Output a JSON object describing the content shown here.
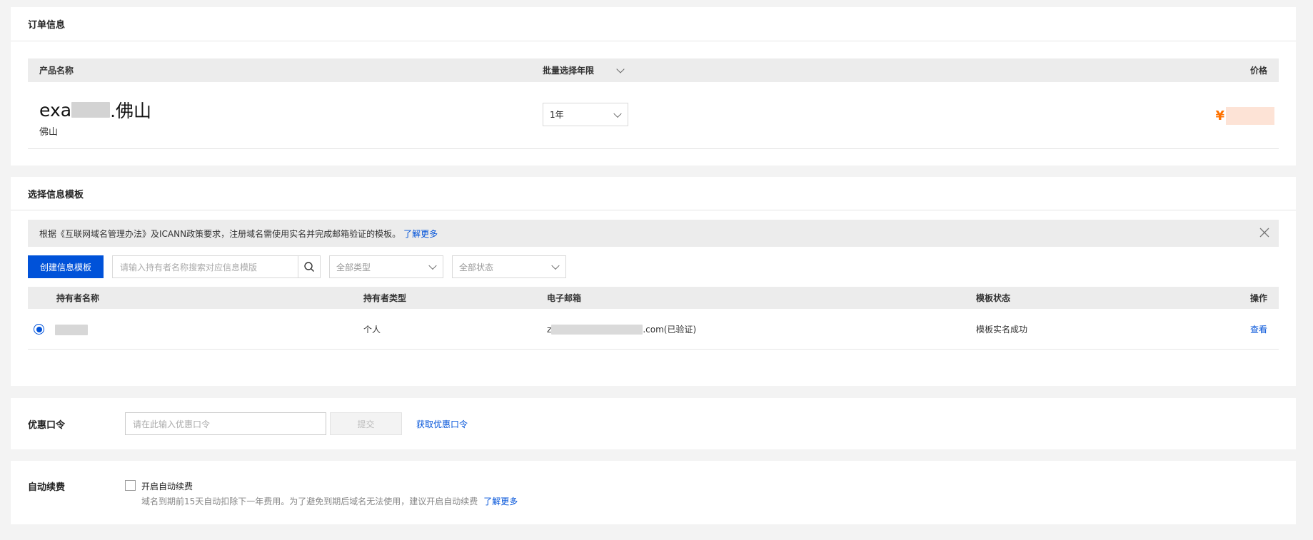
{
  "order": {
    "title": "订单信息",
    "col_product": "产品名称",
    "col_batch": "批量选择年限",
    "col_price": "价格",
    "product_name_prefix": "exa",
    "product_name_suffix": ".佛山",
    "product_sub": "佛山",
    "year_value": "1年",
    "currency": "¥"
  },
  "template": {
    "title": "选择信息模板",
    "notice": "根据《互联网域名管理办法》及ICANN政策要求，注册域名需使用实名并完成邮箱验证的模板。",
    "notice_link": "了解更多",
    "create_button": "创建信息模板",
    "search_placeholder": "请输入持有者名称搜索对应信息模版",
    "type_filter": "全部类型",
    "status_filter": "全部状态",
    "columns": {
      "holder": "持有者名称",
      "type": "持有者类型",
      "email": "电子邮箱",
      "status": "模板状态",
      "action": "操作"
    },
    "rows": [
      {
        "type": "个人",
        "email_prefix": "z",
        "email_suffix": ".com(已验证)",
        "status": "模板实名成功",
        "action": "查看"
      }
    ]
  },
  "coupon": {
    "label": "优惠口令",
    "placeholder": "请在此输入优惠口令",
    "submit": "提交",
    "get_link": "获取优惠口令"
  },
  "autorenew": {
    "label": "自动续费",
    "checkbox_label": "开启自动续费",
    "desc": "域名到期前15天自动扣除下一年费用。为了避免到期后域名无法使用，建议开启自动续费",
    "desc_link": "了解更多"
  },
  "colors": {
    "accent": "#0052d9",
    "price": "#ff7200"
  }
}
